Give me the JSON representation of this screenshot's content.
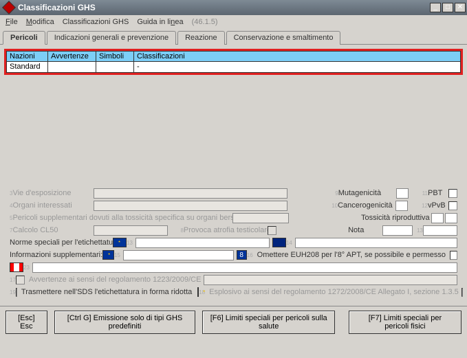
{
  "title": "Classificazioni GHS",
  "menu": {
    "file": "File",
    "modifica": "Modifica",
    "ghs": "Classificazioni GHS",
    "guida": "Guida in linea",
    "version": "(46.1.5)"
  },
  "tabs": [
    "Pericoli",
    "Indicazioni generali e prevenzione",
    "Reazione",
    "Conservazione e smaltimento"
  ],
  "table": {
    "headers": [
      "Nazioni",
      "Avvertenze",
      "Simboli",
      "Classificazioni"
    ],
    "rows": [
      {
        "nazioni": "Standard",
        "avvertenze": "",
        "simboli": "",
        "classificazioni": "-"
      }
    ]
  },
  "labels": {
    "vie": "Vie d'esposizione",
    "organi": "Organi interessati",
    "pericoli_supp_toss": "Pericoli supplementari dovuti alla tossicità specifica su organi bersaglio",
    "calcolo": "Calcolo CL50",
    "atrofia": "Provoca atrofia testicolare",
    "muta": "Mutagenicità",
    "cancer": "Cancerogenicità",
    "toss_rip": "Tossicità riproduttiva",
    "pbt": "PBT",
    "vpvb": "vPvB",
    "nota": "Nota",
    "norme": "Norme speciali per l'etichettatura:",
    "info_supp": "Informazioni supplementari:",
    "omettere": "Omettere EUH208 per l'8° APT, se possibile e permesso",
    "n8": "8",
    "avvert_1223": "Avvertenze ai sensi del regolamento 1223/2009/CE",
    "trasmettere": "Trasmettere nell'SDS l'etichettatura in forma ridotta",
    "esplosivo": "Esplosivo ai sensi del regolamento 1272/2008/CE Allegato I, sezione 1.3.5"
  },
  "buttons": {
    "esc": "[Esc] Esc",
    "ctrlg": "[Ctrl G] Emissione solo di tipi GHS predefiniti",
    "f6": "[F6] Limiti speciali per pericoli sulla salute",
    "f7": "[F7] Limiti speciali per pericoli fisici"
  }
}
